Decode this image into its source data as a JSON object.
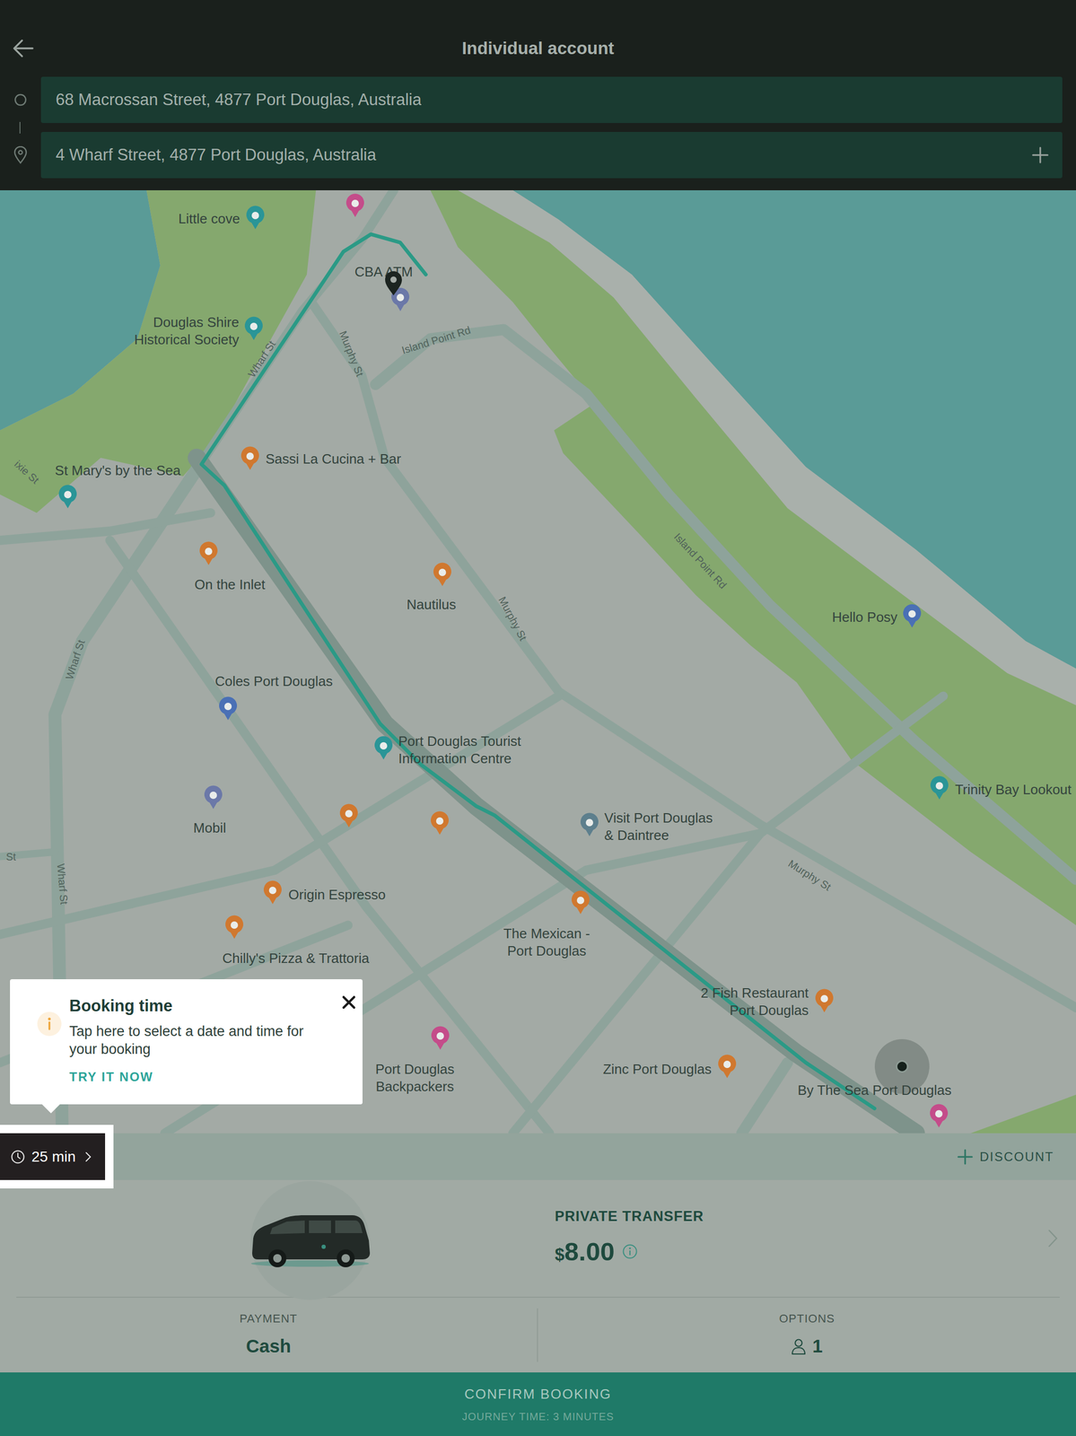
{
  "header": {
    "title": "Individual account"
  },
  "route": {
    "origin": "68 Macrossan Street, 4877 Port Douglas, Australia",
    "destination": "4 Wharf Street, 4877 Port Douglas, Australia"
  },
  "map": {
    "places": [
      {
        "label": [
          "Little cove"
        ],
        "color": "#2a9597"
      },
      {
        "label": [
          "CBA ATM"
        ],
        "color": "#6b78a8"
      },
      {
        "label": [
          "Douglas Shire",
          "Historical Society"
        ],
        "color": "#2a9597"
      },
      {
        "label": [
          "St Mary's by the Sea"
        ],
        "color": "#2a9597"
      },
      {
        "label": [
          "Sassi La Cucina + Bar"
        ],
        "color": "#d0782f"
      },
      {
        "label": [
          "On the Inlet"
        ],
        "color": "#d0782f"
      },
      {
        "label": [
          "Nautilus"
        ],
        "color": "#d0782f"
      },
      {
        "label": [
          "Coles Port Douglas"
        ],
        "color": "#4a70b5"
      },
      {
        "label": [
          "Port Douglas Tourist",
          "Information Centre"
        ],
        "color": "#2a9597"
      },
      {
        "label": [
          "Mobil"
        ],
        "color": "#6b78a8"
      },
      {
        "label": [
          "Visit Port Douglas",
          "& Daintree"
        ],
        "color": "#5d7f8d"
      },
      {
        "label": [
          "Origin Espresso"
        ],
        "color": "#d0782f"
      },
      {
        "label": [
          "Chilly's Pizza & Trattoria"
        ],
        "color": "#d0782f"
      },
      {
        "label": [
          "The Mexican -",
          "Port Douglas"
        ],
        "color": "#d0782f"
      },
      {
        "label": [
          "2 Fish Restaurant",
          "Port Douglas"
        ],
        "color": "#d0782f"
      },
      {
        "label": [
          "Port Douglas",
          "Backpackers"
        ],
        "color": "#c44c8a"
      },
      {
        "label": [
          "Zinc Port Douglas"
        ],
        "color": "#d0782f"
      },
      {
        "label": [
          "By The Sea Port Douglas"
        ],
        "color": "#c44c8a"
      },
      {
        "label": [
          "Hello Posy"
        ],
        "color": "#4a70b5"
      },
      {
        "label": [
          "Trinity Bay Lookout"
        ],
        "color": "#2a9597"
      }
    ],
    "unlabeled_pins": [
      {
        "color": "#c44c8a"
      },
      {
        "color": "#d0782f"
      },
      {
        "color": "#d0782f"
      }
    ],
    "streets": [
      "Wharf St",
      "Murphy St",
      "Island Point Rd",
      "Murphy St",
      "Island Point Rd",
      "Wharf St",
      "Wharf St",
      "Murphy St",
      "ixie St",
      "St"
    ]
  },
  "tooltip": {
    "title": "Booking time",
    "body": "Tap here to select a date and time for your booking",
    "action": "TRY IT NOW"
  },
  "time_button": {
    "label": "25 min"
  },
  "discount": {
    "label": "DISCOUNT"
  },
  "vehicle": {
    "name": "PRIVATE TRANSFER",
    "currency": "$",
    "price": "8.00"
  },
  "payment": {
    "label": "PAYMENT",
    "value": "Cash"
  },
  "options": {
    "label": "OPTIONS",
    "passengers": "1"
  },
  "confirm": {
    "label": "CONFIRM BOOKING",
    "subtitle": "JOURNEY TIME: 3 MINUTES"
  }
}
